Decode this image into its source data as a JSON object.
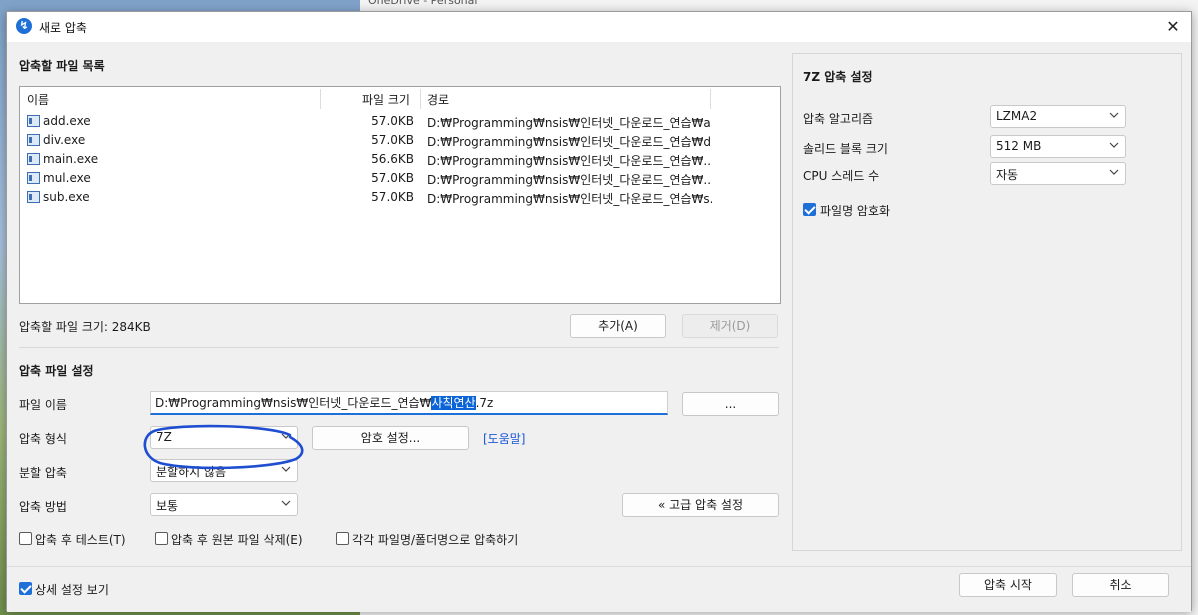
{
  "background": {
    "window_text": "OneDrive - Personal"
  },
  "window": {
    "title": "새로 압축",
    "close_glyph": "✕",
    "app_icon_glyph": "↯"
  },
  "file_list": {
    "section_title": "압축할 파일 목록",
    "columns": {
      "name": "이름",
      "size": "파일 크기",
      "path": "경로"
    },
    "rows": [
      {
        "name": "add.exe",
        "size": "57.0KB",
        "path": "D:₩Programming₩nsis₩인터넷_다운로드_연습₩a..."
      },
      {
        "name": "div.exe",
        "size": "57.0KB",
        "path": "D:₩Programming₩nsis₩인터넷_다운로드_연습₩d..."
      },
      {
        "name": "main.exe",
        "size": "56.6KB",
        "path": "D:₩Programming₩nsis₩인터넷_다운로드_연습₩..."
      },
      {
        "name": "mul.exe",
        "size": "57.0KB",
        "path": "D:₩Programming₩nsis₩인터넷_다운로드_연습₩..."
      },
      {
        "name": "sub.exe",
        "size": "57.0KB",
        "path": "D:₩Programming₩nsis₩인터넷_다운로드_연습₩s..."
      }
    ],
    "total_label": "압축할 파일 크기: 284KB",
    "add_button": "추가(A)",
    "remove_button": "제거(D)"
  },
  "archive_settings": {
    "section_title": "압축 파일 설정",
    "filename_label": "파일 이름",
    "filename_prefix": "D:₩Programming₩nsis₩인터넷_다운로드_연습₩",
    "filename_selected": "사칙연산",
    "filename_suffix": ".7z",
    "browse_button": "...",
    "format_label": "압축 형식",
    "format_value": "7Z",
    "password_button": "암호 설정...",
    "help_link": "[도움말]",
    "split_label": "분할 압축",
    "split_value": "분할하지 않음",
    "method_label": "압축 방법",
    "method_value": "보통",
    "advanced_button": "« 고급 압축 설정",
    "test_after_label": "압축 후 테스트(T)",
    "delete_after_label": "압축 후 원본 파일 삭제(E)",
    "each_file_label": "각각 파일명/폴더명으로 압축하기"
  },
  "seven_z": {
    "section_title": "7Z 압축 설정",
    "algorithm_label": "압축 알고리즘",
    "algorithm_value": "LZMA2",
    "solid_label": "솔리드 블록 크기",
    "solid_value": "512 MB",
    "threads_label": "CPU 스레드 수",
    "threads_value": "자동",
    "encrypt_names_label": "파일명 암호화",
    "encrypt_names_checked": true
  },
  "bottom": {
    "show_details_label": "상세 설정 보기",
    "show_details_checked": true,
    "start_button": "압축 시작",
    "cancel_button": "취소"
  },
  "colors": {
    "accent": "#1f6fd8",
    "annotation": "#1f4fd0",
    "link": "#1a57d6"
  }
}
